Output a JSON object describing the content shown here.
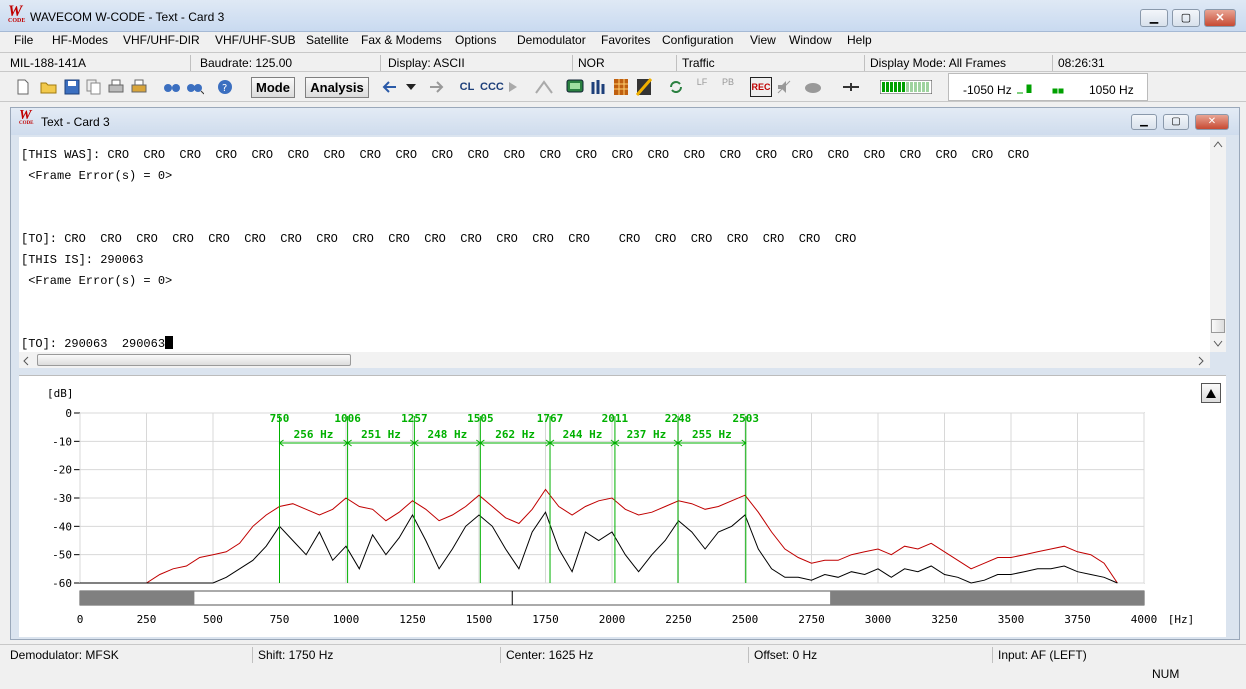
{
  "window": {
    "title": "WAVECOM W-CODE - Text  - Card 3",
    "icon_text": "W",
    "icon_sub": "CODE",
    "buttons": {
      "min": "▁",
      "max": "▢",
      "close": "✕"
    }
  },
  "menu": [
    "File",
    "HF-Modes",
    "VHF/UHF-DIR",
    "VHF/UHF-SUB",
    "Satellite",
    "Fax & Modems",
    "Options",
    "Demodulator",
    "Favorites",
    "Configuration",
    "View",
    "Window",
    "Help"
  ],
  "status": {
    "mode": "MIL-188-141A",
    "baudrate": "Baudrate: 125.00",
    "display": "Display: ASCII",
    "polarity": "NOR",
    "traffic": "Traffic",
    "display_mode": "Display Mode: All Frames",
    "time": "08:26:31"
  },
  "toolbar": {
    "mode_label": "Mode",
    "analysis_label": "Analysis",
    "cl_label": "CL",
    "ccc_label": "CCC",
    "lf_label": "LF",
    "pb_label": "PB",
    "rec_label": "REC",
    "freq_left": "-1050 Hz",
    "freq_right": "1050 Hz",
    "signal_level": 0.45,
    "icons": [
      "new-icon",
      "open-icon",
      "save-icon",
      "copy-icon",
      "print-icon",
      "print-preview-icon",
      "find-icon",
      "find-next-icon",
      "help-icon",
      "arrow-left-icon",
      "dropdown-icon",
      "arrow-right-icon",
      "play-icon",
      "tune-icon",
      "display-icon",
      "bars-icon",
      "grid-icon",
      "pattern-icon",
      "refresh-icon",
      "rec-icon",
      "mute-icon",
      "cloud-icon",
      "zoom-icon",
      "level-meter-icon"
    ]
  },
  "child": {
    "title": "Text  - Card 3",
    "buttons": {
      "min": "▁",
      "max": "▢",
      "close": "✕"
    },
    "lines": [
      "[THIS WAS]: CRO  CRO  CRO  CRO  CRO  CRO  CRO  CRO  CRO  CRO  CRO  CRO  CRO  CRO  CRO  CRO  CRO  CRO  CRO  CRO  CRO  CRO  CRO  CRO  CRO  CRO",
      " <Frame Error(s) = 0>",
      "",
      "",
      "[TO]: CRO  CRO  CRO  CRO  CRO  CRO  CRO  CRO  CRO  CRO  CRO  CRO  CRO  CRO  CRO    CRO  CRO  CRO  CRO  CRO  CRO  CRO",
      "[THIS IS]: 290063",
      " <Frame Error(s) = 0>",
      "",
      "",
      "[TO]: 290063  290063"
    ]
  },
  "spectrum": {
    "ylabel": "[dB]",
    "xunit": "[Hz]",
    "yticks": [
      "0",
      "-10",
      "-20",
      "-30",
      "-40",
      "-50",
      "-60"
    ],
    "xticks": [
      "0",
      "250",
      "500",
      "750",
      "1000",
      "1250",
      "1500",
      "1750",
      "2000",
      "2250",
      "2500",
      "2750",
      "3000",
      "3250",
      "3500",
      "3750",
      "4000"
    ],
    "markers": [
      "750",
      "1006",
      "1257",
      "1505",
      "1767",
      "2011",
      "2248",
      "2503"
    ],
    "spacings": [
      "256 Hz",
      "251 Hz",
      "248 Hz",
      "262 Hz",
      "244 Hz",
      "237 Hz",
      "255 Hz"
    ],
    "range_bar": {
      "filter_low": 430,
      "filter_high": 2820,
      "center": 1625
    },
    "colors": {
      "peak": "#c00000",
      "current": "#000000",
      "marker": "#00b000",
      "grid": "#d8d8d8"
    }
  },
  "chart_data": {
    "type": "line",
    "xlabel": "[Hz]",
    "ylabel": "[dB]",
    "xlim": [
      0,
      4000
    ],
    "ylim": [
      -60,
      0
    ],
    "grid": true,
    "x": [
      0,
      100,
      200,
      250,
      300,
      350,
      400,
      450,
      500,
      550,
      600,
      650,
      700,
      750,
      800,
      850,
      900,
      950,
      1000,
      1050,
      1100,
      1150,
      1200,
      1250,
      1300,
      1350,
      1400,
      1450,
      1500,
      1550,
      1600,
      1650,
      1700,
      1750,
      1800,
      1850,
      1900,
      1950,
      2000,
      2050,
      2100,
      2150,
      2200,
      2250,
      2300,
      2350,
      2400,
      2450,
      2500,
      2550,
      2600,
      2650,
      2700,
      2750,
      2800,
      2850,
      2900,
      2950,
      3000,
      3050,
      3100,
      3150,
      3200,
      3250,
      3300,
      3350,
      3400,
      3450,
      3500,
      3550,
      3600,
      3650,
      3700,
      3750,
      3800,
      3850,
      3900
    ],
    "series": [
      {
        "values": [
          -70,
          -70,
          -62,
          -60,
          -57,
          -55,
          -54,
          -51,
          -50,
          -49,
          -46,
          -40,
          -36,
          -33,
          -32,
          -34,
          -36,
          -34,
          -30,
          -33,
          -34,
          -38,
          -35,
          -31,
          -34,
          -38,
          -36,
          -33,
          -29,
          -33,
          -37,
          -39,
          -34,
          -27,
          -33,
          -36,
          -33,
          -31,
          -30,
          -34,
          -36,
          -35,
          -33,
          -31,
          -32,
          -34,
          -33,
          -31,
          -29,
          -35,
          -42,
          -48,
          -51,
          -53,
          -52,
          -52,
          -50,
          -49,
          -48,
          -50,
          -47,
          -48,
          -46,
          -49,
          -52,
          -55,
          -53,
          -51,
          -51,
          -50,
          -49,
          -48,
          -47,
          -49,
          -50,
          -53,
          -60
        ]
      },
      {
        "values": [
          -75,
          -75,
          -72,
          -70,
          -66,
          -62,
          -60,
          -60,
          -60,
          -58,
          -55,
          -52,
          -47,
          -40,
          -45,
          -50,
          -42,
          -52,
          -47,
          -55,
          -43,
          -50,
          -44,
          -36,
          -45,
          -55,
          -48,
          -40,
          -36,
          -40,
          -48,
          -55,
          -42,
          -35,
          -48,
          -56,
          -42,
          -45,
          -42,
          -50,
          -56,
          -50,
          -45,
          -38,
          -42,
          -48,
          -42,
          -40,
          -36,
          -48,
          -55,
          -58,
          -58,
          -59,
          -57,
          -58,
          -56,
          -57,
          -55,
          -58,
          -55,
          -56,
          -54,
          -57,
          -58,
          -60,
          -59,
          -57,
          -57,
          -56,
          -55,
          -55,
          -54,
          -56,
          -57,
          -58,
          -62
        ]
      }
    ]
  },
  "bottom": {
    "demodulator": "Demodulator: MFSK",
    "shift": "Shift: 1750 Hz",
    "center": "Center: 1625 Hz",
    "offset": "Offset: 0 Hz",
    "input": "Input: AF (LEFT)",
    "num": "NUM"
  }
}
